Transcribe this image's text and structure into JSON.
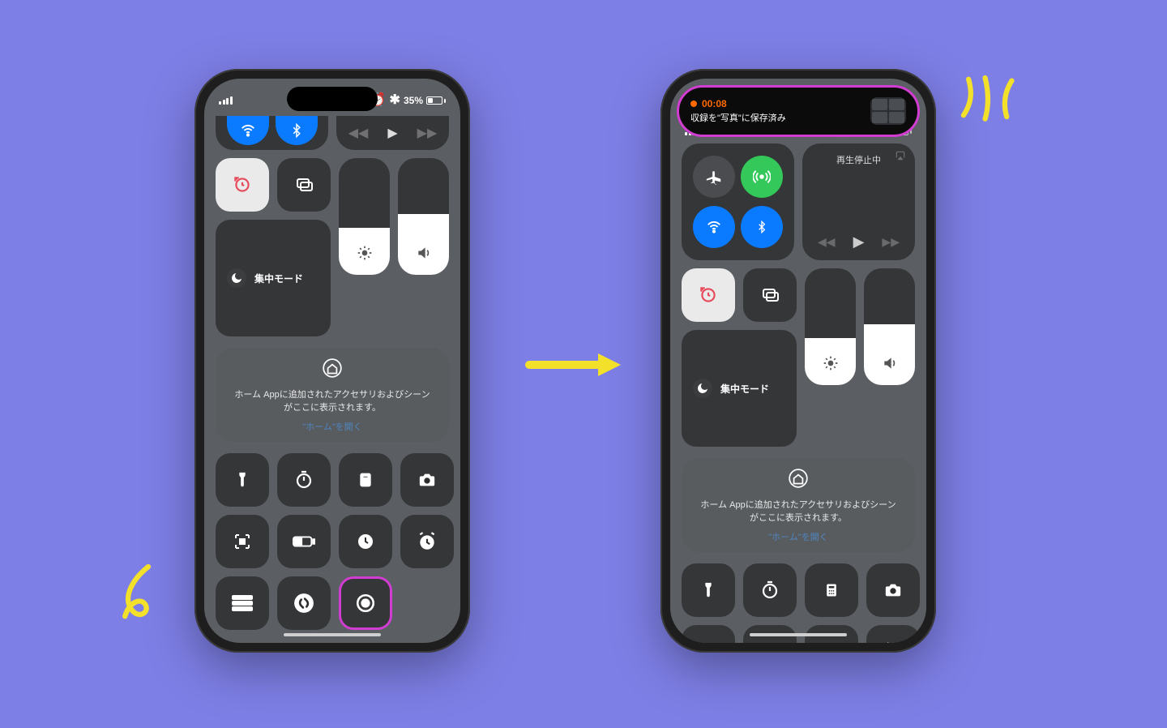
{
  "colors": {
    "bg": "#7e7fe6",
    "accent": "#d13cd1",
    "doodle": "#f3e02a",
    "blue": "#0a7aff",
    "green": "#34c759"
  },
  "status": {
    "battery_pct": "35%",
    "indicators": "◎ ⏰ ⁂"
  },
  "phones": {
    "left": {
      "focus_label": "集中モード",
      "home_text": "ホーム Appに追加されたアクセサリおよびシーンがここに表示されます。",
      "home_link": "\"ホーム\"を開く"
    },
    "right": {
      "rec_time": "00:08",
      "rec_message": "収録を\"写真\"に保存済み",
      "media_label": "再生停止中",
      "focus_label": "集中モード",
      "home_text": "ホーム Appに追加されたアクセサリおよびシーンがここに表示されます。",
      "home_link": "\"ホーム\"を開く"
    }
  },
  "icons": {
    "wifi": "wifi",
    "bluetooth": "bluetooth",
    "airplane": "airplane",
    "cellular": "cellular-antenna",
    "airplay": "airplay",
    "play": "play",
    "prev": "prev",
    "next": "next",
    "rotation_lock": "rotation-lock",
    "screen_mirror": "screen-mirror",
    "moon": "moon",
    "brightness": "brightness",
    "volume": "volume",
    "home": "home",
    "flashlight": "flashlight",
    "timer": "timer",
    "calculator": "calculator",
    "camera": "camera",
    "qr": "qr-code",
    "low_power": "low-power",
    "clock": "clock",
    "alarm": "alarm",
    "wallet": "wallet",
    "shazam": "shazam",
    "screen_record": "screen-record"
  }
}
